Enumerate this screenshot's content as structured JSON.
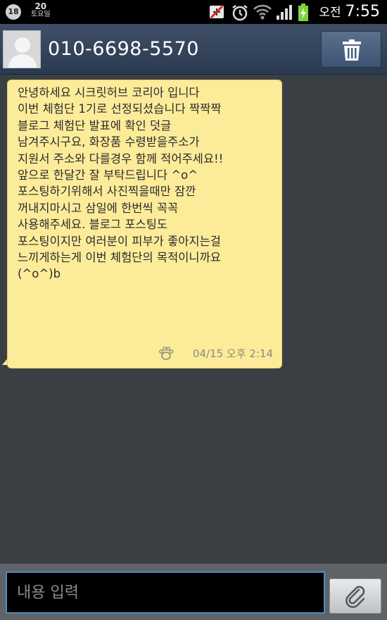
{
  "status_bar": {
    "notification_count": "18",
    "date_day": "20",
    "date_weekday": "토요일",
    "ampm": "오전",
    "time": "7:55",
    "icons": [
      "usb-blocked-icon",
      "alarm-icon",
      "wifi-icon",
      "signal-icon",
      "battery-charging-icon"
    ]
  },
  "header": {
    "contact_number": "010-6698-5570",
    "avatar_icon": "person-silhouette-icon",
    "delete_icon": "trash-icon"
  },
  "message": {
    "lines": [
      "안녕하세요 시크릿허브 코리아 입니다",
      "이번 체험단 1기로 선정되셨습니다 짝짝짝",
      "블로그 체험단 발표에 확인 덧글",
      "남겨주시구요, 화장품 수령받을주소가",
      "지원서 주소와 다를경우 함께 적어주세요!!",
      "앞으로 한달간 잘 부탁드립니다 ^o^",
      "포스팅하기위해서 사진찍을때만 잠깐",
      "꺼내지마시고 삼일에 한번씩 꼭꼭",
      "사용해주세요. 블로그 포스팅도",
      "포스팅이지만 여러분이 피부가 좋아지는걸",
      "느끼게하는게 이번 체험단의 목적이니까요",
      "(^o^)b"
    ],
    "timestamp": "04/15 오후 2:14",
    "status_icon": "paw-icon",
    "bubble_color": "#fcec9a"
  },
  "composer": {
    "placeholder": "내용 입력",
    "attach_icon": "paperclip-icon",
    "focus_color": "#4a8fc7"
  }
}
